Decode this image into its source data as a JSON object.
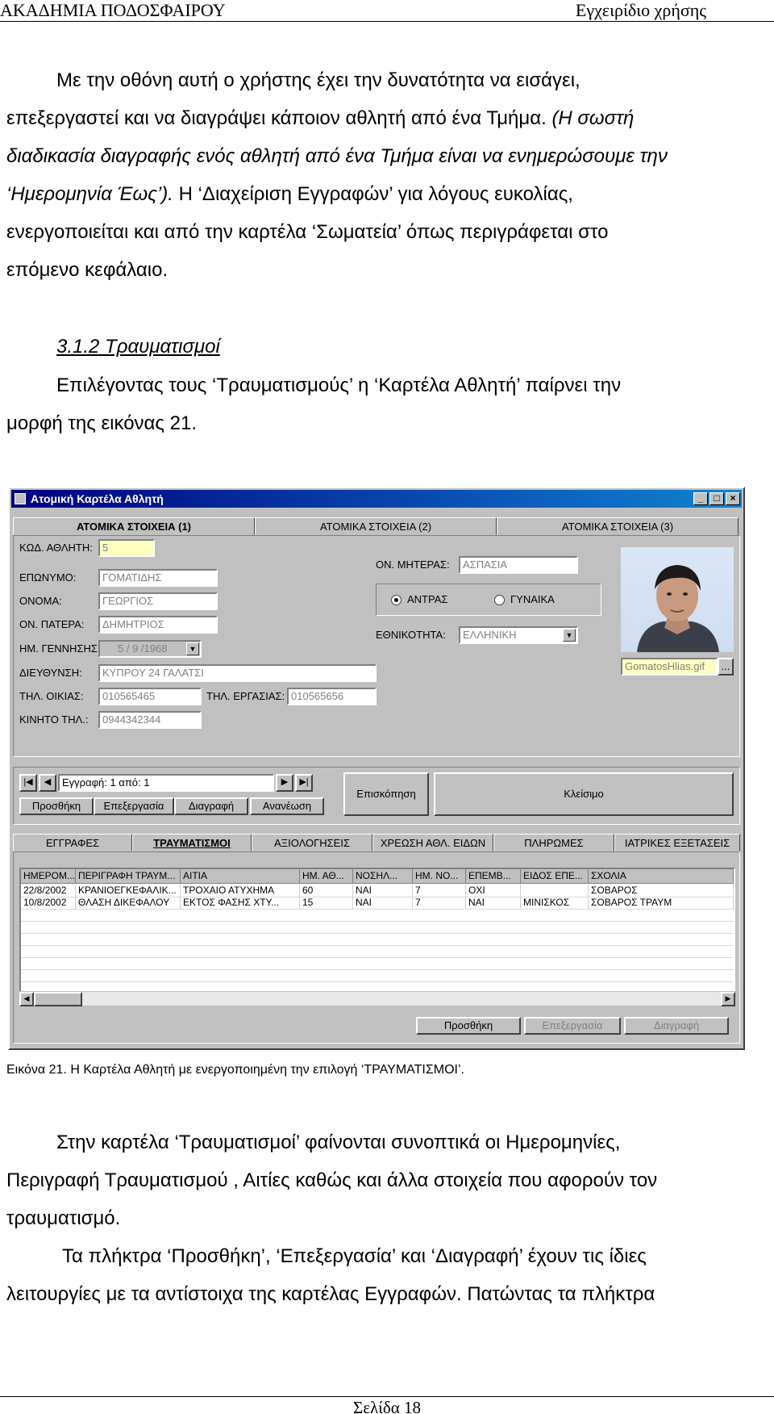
{
  "header": {
    "left": "ΑΚΑΔΗΜΙΑ ΠΟΔΟΣΦΑΙΡΟΥ",
    "right": "Εγχειρίδιο χρήσης"
  },
  "paragraph1": {
    "line1": "Με την οθόνη αυτή ο χρήστης έχει την δυνατότητα να εισάγει,",
    "line2a": "επεξεργαστεί και να διαγράψει κάποιον αθλητή από ένα Τμήμα. ",
    "line2b": "(Η σωστή",
    "line3": "διαδικασία διαγραφής ενός αθλητή από ένα Τμήμα είναι να ενημερώσουμε την",
    "line4a": "‘Ημερομηνία Έως’).",
    "line4b": " Η ‘Διαχείριση Εγγραφών’ για λόγους ευκολίας,",
    "line5": "ενεργοποιείται και από την καρτέλα ‘Σωματεία’ όπως περιγράφεται στο",
    "line6": "επόμενο κεφάλαιο."
  },
  "section": {
    "title": "3.1.2 Τραυματισμοί"
  },
  "paragraph2": {
    "line1": "Επιλέγοντας τους ‘Τραυματισμούς’ η ‘Καρτέλα Αθλητή’ παίρνει την",
    "line2": "μορφή της εικόνας 21."
  },
  "window": {
    "title": "Ατομική Καρτέλα Αθλητή",
    "top_tabs": [
      "ΑΤΟΜΙΚΑ ΣΤΟΙΧΕΙΑ (1)",
      "ΑΤΟΜΙΚΑ ΣΤΟΙΧΕΙΑ (2)",
      "ΑΤΟΜΙΚΑ ΣΤΟΙΧΕΙΑ (3)"
    ],
    "labels": {
      "code": "ΚΩΔ. ΑΘΛΗΤΗ:",
      "surname": "ΕΠΩΝΥΜΟ:",
      "name": "ΟΝΟΜΑ:",
      "father": "ΟΝ. ΠΑΤΕΡΑ:",
      "birth": "ΗΜ. ΓΕΝΝΗΣΗΣ:",
      "address": "ΔΙΕΥΘΥΝΣΗ:",
      "home_phone": "ΤΗΛ. ΟΙΚΙΑΣ:",
      "work_phone": "ΤΗΛ. ΕΡΓΑΣΙΑΣ:",
      "mobile": "ΚΙΝΗΤΟ ΤΗΛ.:",
      "mother": "ΟΝ. ΜΗΤΕΡΑΣ:",
      "nationality": "ΕΘΝΙΚΟΤΗΤΑ:"
    },
    "values": {
      "code": "5",
      "surname": "ΓΟΜΑΤΙΔΗΣ",
      "name": "ΓΕΩΡΓΙΟΣ",
      "father": "ΔΗΜΗΤΡΙΟΣ",
      "birth": "5 / 9 /1968",
      "address": "ΚΥΠΡΟΥ 24 ΓΑΛΑΤΣΙ",
      "home_phone": "010565465",
      "work_phone": "010565656",
      "mobile": "0944342344",
      "mother": "ΑΣΠΑΣΙΑ",
      "nationality": "ΕΛΛΗΝΙΚΗ",
      "photo_file": "GomatosHlias.gif"
    },
    "gender": {
      "male": "ΑΝΤΡΑΣ",
      "female": "ΓΥΝΑΙΚΑ",
      "selected": "male"
    },
    "browse_label": "...",
    "record": "Εγγραφή: 1 από: 1",
    "nav": {
      "first": "|◀",
      "prev": "◀",
      "next": "▶",
      "last": "▶|"
    },
    "buttons": {
      "add": "Προσθήκη",
      "edit": "Επεξεργασία",
      "delete": "Διαγραφή",
      "refresh": "Ανανέωση",
      "overview": "Επισκόπηση",
      "close": "Κλείσιμο"
    },
    "bottom_tabs": [
      "ΕΓΓΡΑΦΕΣ",
      "ΤΡΑΥΜΑΤΙΣΜΟΙ",
      "ΑΞΙΟΛΟΓΗΣΕΙΣ",
      "ΧΡΕΩΣΗ ΑΘΛ. ΕΙΔΩΝ",
      "ΠΛΗΡΩΜΕΣ",
      "ΙΑΤΡΙΚΕΣ ΕΞΕΤΑΣΕΙΣ"
    ],
    "grid": {
      "columns": [
        "ΗΜΕΡΟΜ....",
        "ΠΕΡΙΓΡΑΦΗ ΤΡΑΥΜ...",
        "ΑΙΤΙΑ",
        "ΗΜ. ΑΘ...",
        "ΝΟΣΗΛ...",
        "ΗΜ. ΝΟ...",
        "ΕΠΕΜΒ...",
        "ΕΙΔΟΣ ΕΠΕ...",
        "ΣΧΟΛΙΑ"
      ],
      "rows": [
        [
          "22/8/2002",
          "ΚΡΑΝΙΟΕΓΚΕΦΑΛΙΚ...",
          "ΤΡΟΧΑΙΟ ΑΤΥΧΗΜΑ",
          "60",
          "ΝΑΙ",
          "7",
          "ΟΧΙ",
          "",
          "ΣΟΒΑΡΟΣ"
        ],
        [
          "10/8/2002",
          "ΘΛΑΣΗ ΔΙΚΕΦΑΛΟΥ",
          "ΕΚΤΟΣ ΦΑΣΗΣ ΧΤΥ...",
          "15",
          "ΝΑΙ",
          "7",
          "ΝΑΙ",
          "ΜΙΝΙΣΚΟΣ",
          "ΣΟΒΑΡΟΣ ΤΡΑΥΜ"
        ]
      ]
    },
    "grid_buttons": {
      "add": "Προσθήκη",
      "edit": "Επεξεργασία",
      "delete": "Διαγραφή"
    }
  },
  "caption": "Εικόνα 21. Η Καρτέλα Αθλητή με ενεργοποιημένη την επιλογή ‘ΤΡΑΥΜΑΤΙΣΜΟΙ’.",
  "paragraph3": {
    "line1": "Στην καρτέλα ‘Τραυματισμοί’ φαίνονται συνοπτικά οι Ημερομηνίες,",
    "line2": "Περιγραφή Τραυματισμού , Αιτίες καθώς και άλλα στοιχεία που αφορούν τον",
    "line3": "τραυματισμό."
  },
  "paragraph4": {
    "line1": "Τα πλήκτρα ‘Προσθήκη’, ‘Επεξεργασία’ και ‘Διαγραφή’ έχουν τις ίδιες",
    "line2": "λειτουργίες με τα αντίστοιχα της καρτέλας Εγγραφών. Πατώντας τα πλήκτρα"
  },
  "footer": "Σελίδα 18"
}
